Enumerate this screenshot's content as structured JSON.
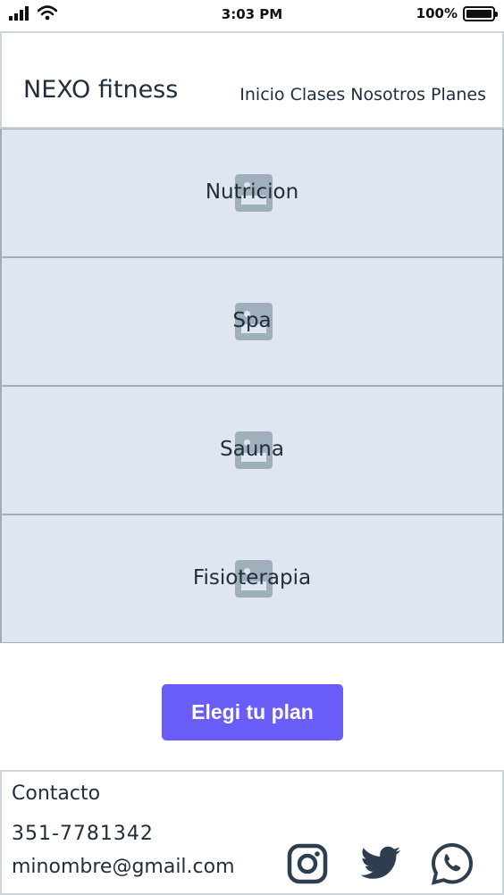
{
  "status_bar": {
    "time": "3:03 PM",
    "battery": "100%",
    "icons": [
      "signal-icon",
      "wifi-icon",
      "battery-icon"
    ]
  },
  "header": {
    "brand": "NEXO fitness",
    "nav": [
      "Inicio",
      "Clases",
      "Nosotros",
      "Planes"
    ]
  },
  "services": [
    {
      "label": "Nutricion",
      "icon": "image-placeholder-icon"
    },
    {
      "label": "Spa",
      "icon": "image-placeholder-icon"
    },
    {
      "label": "Sauna",
      "icon": "image-placeholder-icon"
    },
    {
      "label": "Fisioterapia",
      "icon": "image-placeholder-icon"
    }
  ],
  "cta": {
    "label": "Elegi tu plan",
    "color": "#6a5cf6"
  },
  "footer": {
    "title": "Contacto",
    "phone": "351-7781342",
    "email": "minombre@gmail.com",
    "social": [
      "instagram-icon",
      "twitter-icon",
      "whatsapp-icon"
    ]
  },
  "colors": {
    "text": "#1f2d3d",
    "tile_bg": "#dfe6ef",
    "tile_border": "#a0afbc",
    "accent": "#6a5cf6"
  }
}
